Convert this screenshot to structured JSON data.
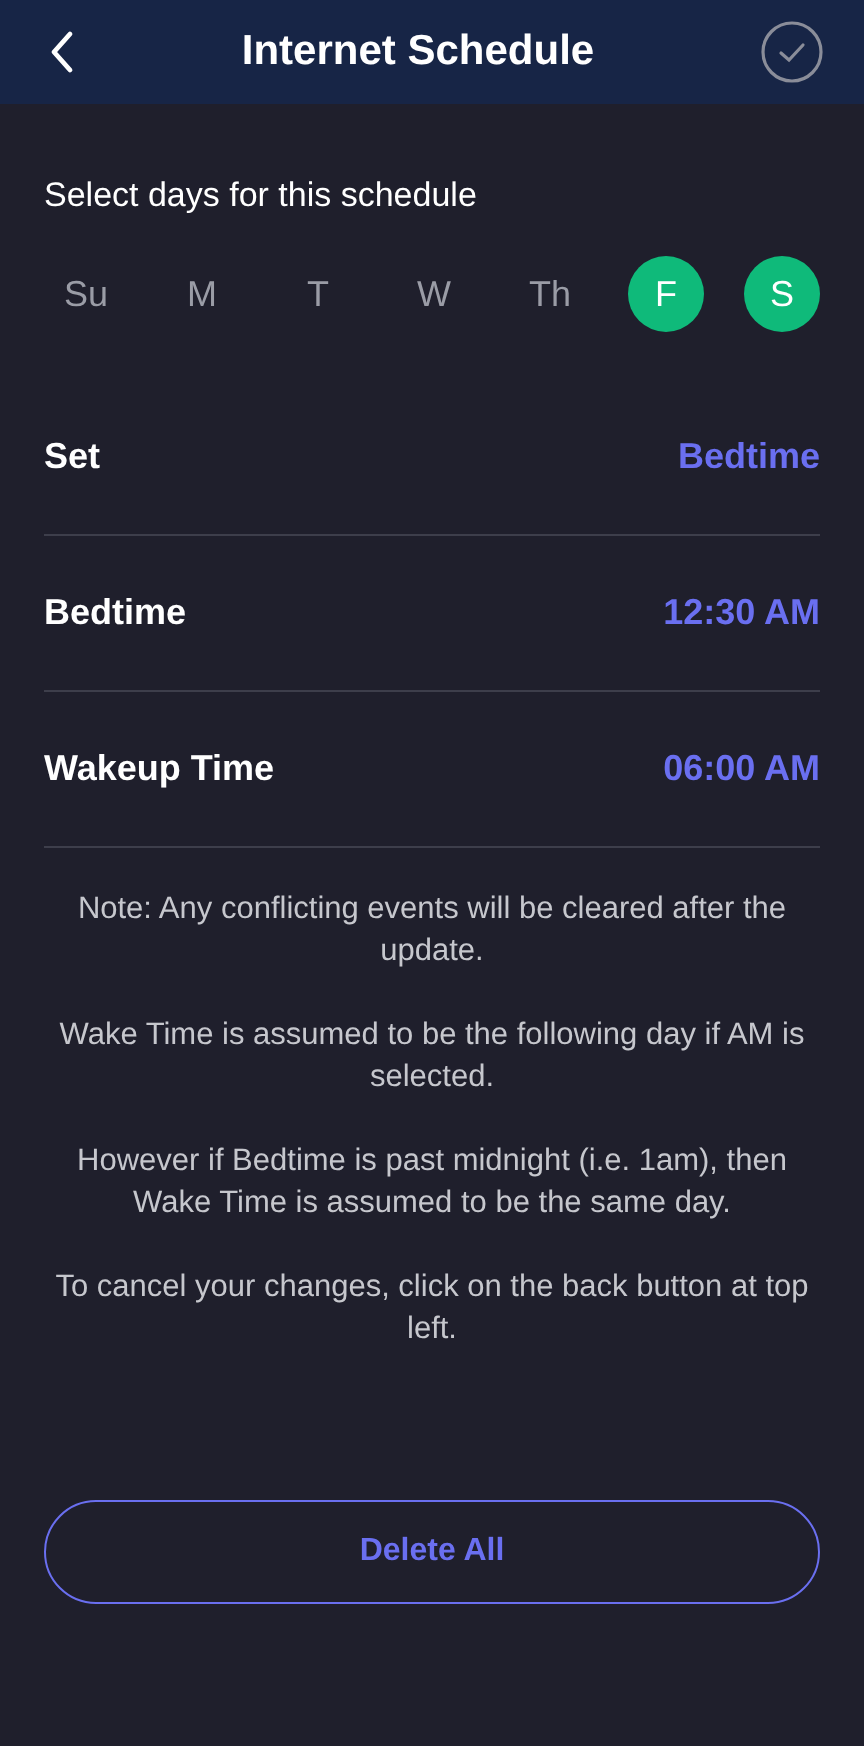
{
  "header": {
    "title": "Internet Schedule"
  },
  "days_label": "Select days for this schedule",
  "days": [
    {
      "label": "Su",
      "selected": false
    },
    {
      "label": "M",
      "selected": false
    },
    {
      "label": "T",
      "selected": false
    },
    {
      "label": "W",
      "selected": false
    },
    {
      "label": "Th",
      "selected": false
    },
    {
      "label": "F",
      "selected": true
    },
    {
      "label": "S",
      "selected": true
    }
  ],
  "settings": [
    {
      "label": "Set",
      "value": "Bedtime"
    },
    {
      "label": "Bedtime",
      "value": "12:30 AM"
    },
    {
      "label": "Wakeup Time",
      "value": "06:00 AM"
    }
  ],
  "notes": [
    "Note: Any conflicting events will be cleared after the update.",
    "Wake Time is assumed to be the following day if AM is selected.",
    "However if Bedtime is past midnight (i.e. 1am), then Wake Time is assumed to be the same day.",
    "To cancel your changes, click on the back button at top left."
  ],
  "delete_button": "Delete All"
}
